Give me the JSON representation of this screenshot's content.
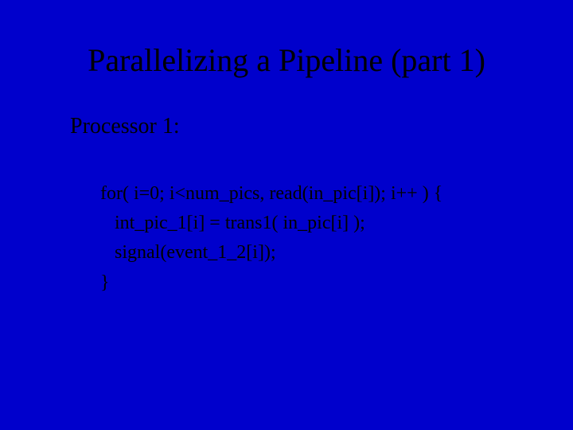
{
  "title": "Parallelizing a Pipeline (part 1)",
  "subheading": "Processor 1:",
  "code": {
    "l1": "for( i=0; i<num_pics, read(in_pic[i]); i++ ) {",
    "l2": "   int_pic_1[i] = trans1( in_pic[i] );",
    "l3": "   signal(event_1_2[i]);",
    "l4": "}"
  }
}
